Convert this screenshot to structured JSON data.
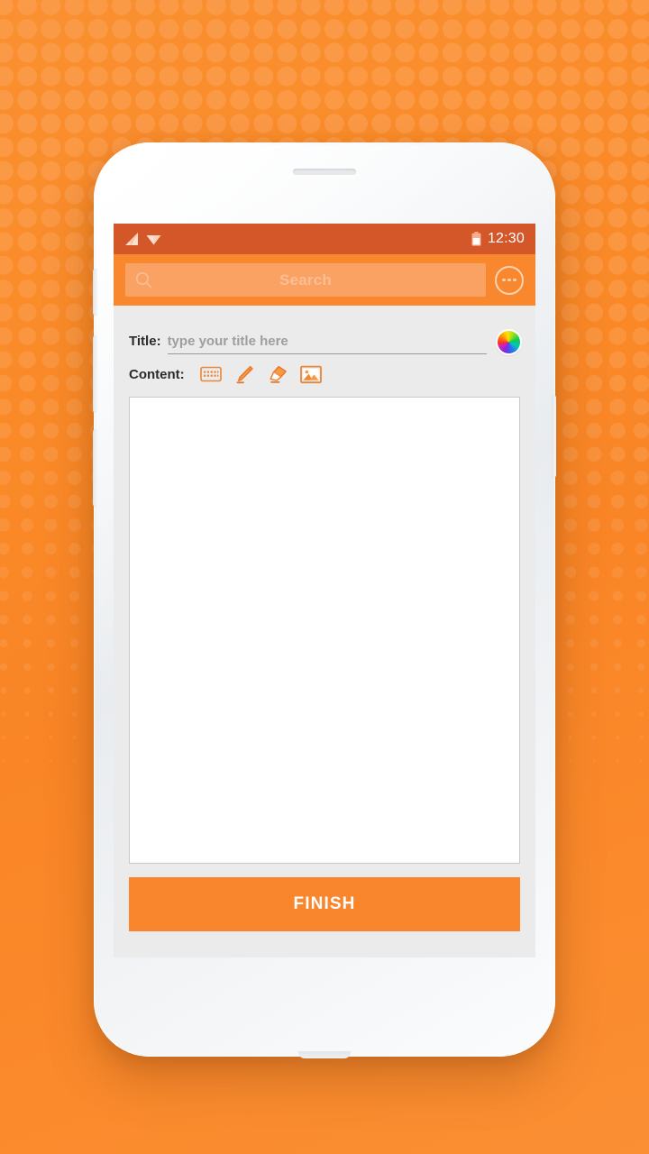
{
  "background": {
    "base_color": "#FA8A28",
    "dot_color": "#FBA257",
    "pattern": "polka-dots-fading"
  },
  "device": {
    "frame_color": "#EDEFF2",
    "speaker_name": "earpiece-speaker",
    "buttons": [
      "volume-up",
      "volume-down",
      "power",
      "side-button"
    ]
  },
  "status_bar": {
    "background": "#D4572A",
    "signal_icon": "signal-bars-icon",
    "wifi_icon": "wifi-icon",
    "battery_icon": "battery-half-icon",
    "time": "12:30"
  },
  "app_bar": {
    "background": "#F9872D",
    "search": {
      "icon": "search-icon",
      "placeholder": "Search",
      "value": "",
      "background": "#FAA164"
    },
    "overflow_menu": {
      "icon": "overflow-menu-icon",
      "label": "More options"
    }
  },
  "editor": {
    "title_field": {
      "label": "Title:",
      "placeholder": "type your title here",
      "value": ""
    },
    "color_picker": {
      "name": "color-wheel-icon",
      "label": "Color"
    },
    "content": {
      "label": "Content:",
      "tools": [
        {
          "name": "keyboard-icon",
          "label": "Text",
          "color": "#E8873A"
        },
        {
          "name": "pencil-icon",
          "label": "Draw",
          "color": "#F08A2E"
        },
        {
          "name": "eraser-icon",
          "label": "Erase",
          "color": "#F08A2E"
        },
        {
          "name": "image-icon",
          "label": "Image",
          "color": "#E8873A"
        }
      ]
    },
    "canvas": {
      "name": "drawing-canvas",
      "background": "#FFFFFF",
      "content": ""
    }
  },
  "footer": {
    "finish_label": "FINISH",
    "finish_color": "#F9862C"
  }
}
